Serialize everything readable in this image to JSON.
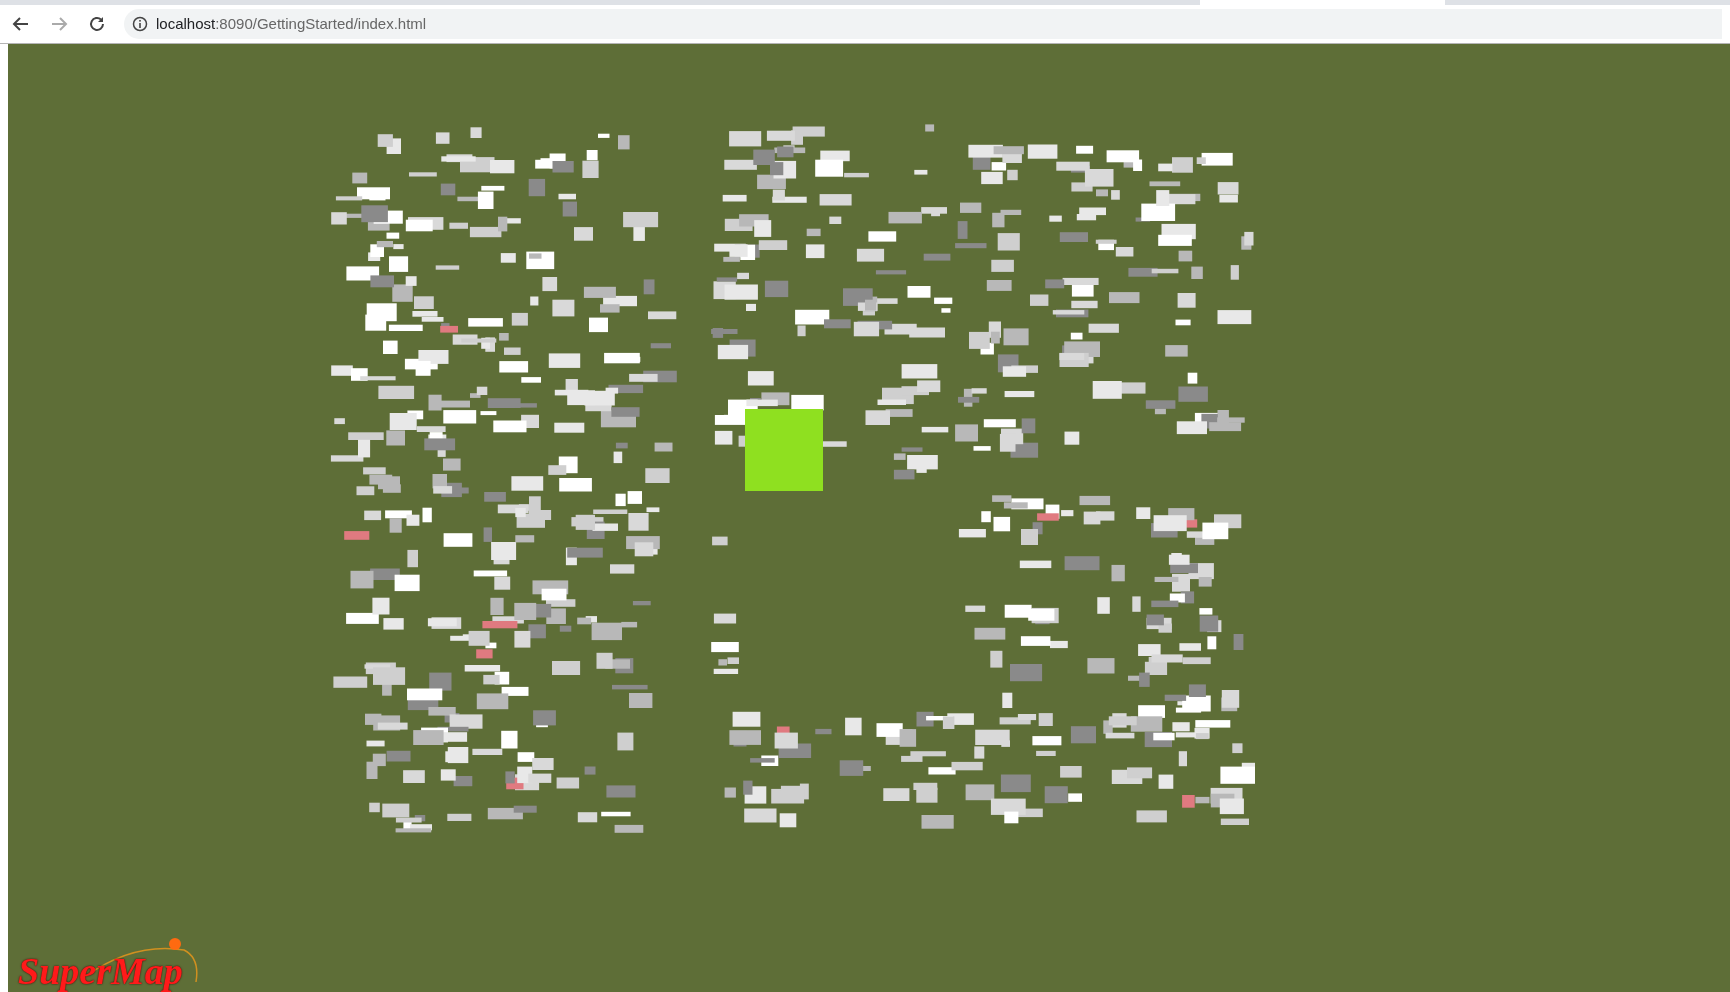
{
  "address_bar": {
    "host": "localhost",
    "path": ":8090/GettingStarted/index.html"
  },
  "logo": {
    "text": "SuperMap"
  }
}
